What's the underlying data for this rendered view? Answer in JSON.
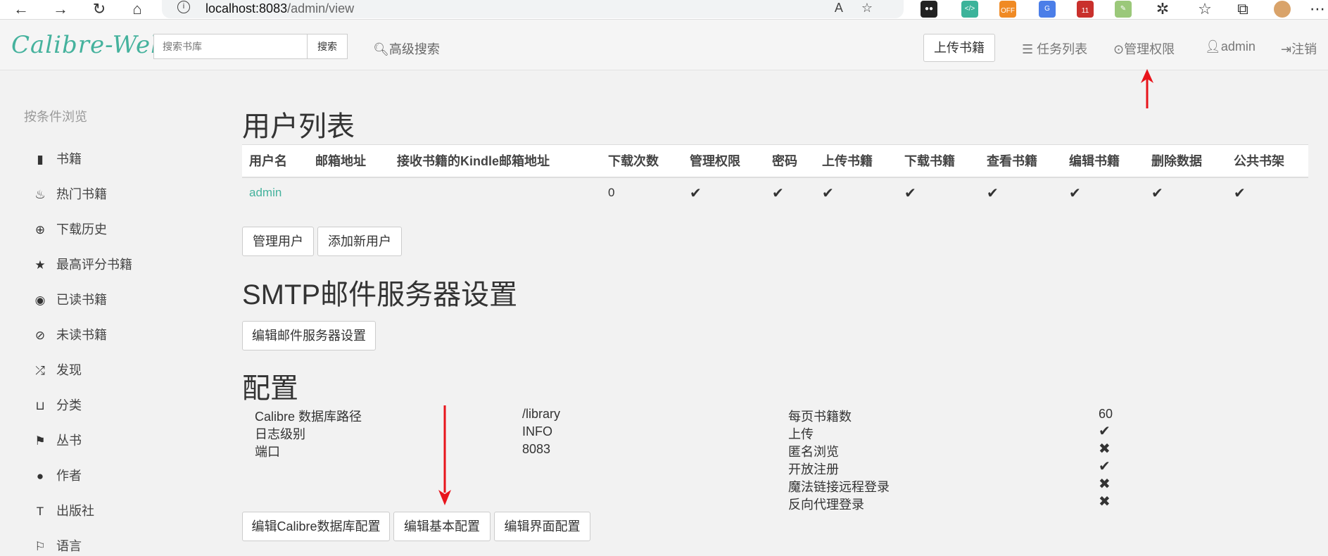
{
  "browser": {
    "url_host": "localhost:8083",
    "url_path": "/admin/view",
    "ext_off_label": "OFF",
    "ext_badge_count": "11"
  },
  "header": {
    "logo": "Calibre-Web",
    "search_placeholder": "搜索书库",
    "search_button": "搜索",
    "advanced_search": "高级搜索",
    "upload": "上传书籍",
    "tasks": "任务列表",
    "admin_rights": "管理权限",
    "user": "admin",
    "logout": "注销"
  },
  "sidebar": {
    "title": "按条件浏览",
    "items": [
      {
        "label": "书籍",
        "icon": "book-icon"
      },
      {
        "label": "热门书籍",
        "icon": "fire-icon"
      },
      {
        "label": "下载历史",
        "icon": "download-circle-icon"
      },
      {
        "label": "最高评分书籍",
        "icon": "star-icon"
      },
      {
        "label": "已读书籍",
        "icon": "eye-icon"
      },
      {
        "label": "未读书籍",
        "icon": "eye-slash-icon"
      },
      {
        "label": "发现",
        "icon": "shuffle-icon"
      },
      {
        "label": "分类",
        "icon": "inbox-icon"
      },
      {
        "label": "丛书",
        "icon": "bookmark-icon"
      },
      {
        "label": "作者",
        "icon": "user-icon"
      },
      {
        "label": "出版社",
        "icon": "text-size-icon"
      },
      {
        "label": "语言",
        "icon": "flag-icon"
      }
    ]
  },
  "users_section": {
    "title": "用户列表",
    "columns": [
      "用户名",
      "邮箱地址",
      "接收书籍的Kindle邮箱地址",
      "下载次数",
      "管理权限",
      "密码",
      "上传书籍",
      "下载书籍",
      "查看书籍",
      "编辑书籍",
      "删除数据",
      "公共书架"
    ],
    "rows": [
      {
        "username": "admin",
        "email": "",
        "kindle": "",
        "downloads": "0",
        "checks": [
          true,
          true,
          true,
          true,
          true,
          true,
          true,
          true
        ]
      }
    ],
    "manage_users": "管理用户",
    "add_user": "添加新用户"
  },
  "smtp_section": {
    "title": "SMTP邮件服务器设置",
    "edit_button": "编辑邮件服务器设置"
  },
  "config_section": {
    "title": "配置",
    "left": [
      {
        "label": "Calibre 数据库路径",
        "value": "/library"
      },
      {
        "label": "日志级别",
        "value": "INFO"
      },
      {
        "label": "端口",
        "value": "8083"
      }
    ],
    "right": [
      {
        "label": "每页书籍数",
        "value": "60",
        "icon": ""
      },
      {
        "label": "上传",
        "value": "",
        "icon": "check"
      },
      {
        "label": "匿名浏览",
        "value": "",
        "icon": "cross"
      },
      {
        "label": "开放注册",
        "value": "",
        "icon": "check"
      },
      {
        "label": "魔法链接远程登录",
        "value": "",
        "icon": "cross"
      },
      {
        "label": "反向代理登录",
        "value": "",
        "icon": "cross"
      }
    ],
    "buttons": [
      "编辑Calibre数据库配置",
      "编辑基本配置",
      "编辑界面配置"
    ]
  },
  "colors": {
    "accent": "#45b29d",
    "annotation_arrow": "#e8141b"
  }
}
